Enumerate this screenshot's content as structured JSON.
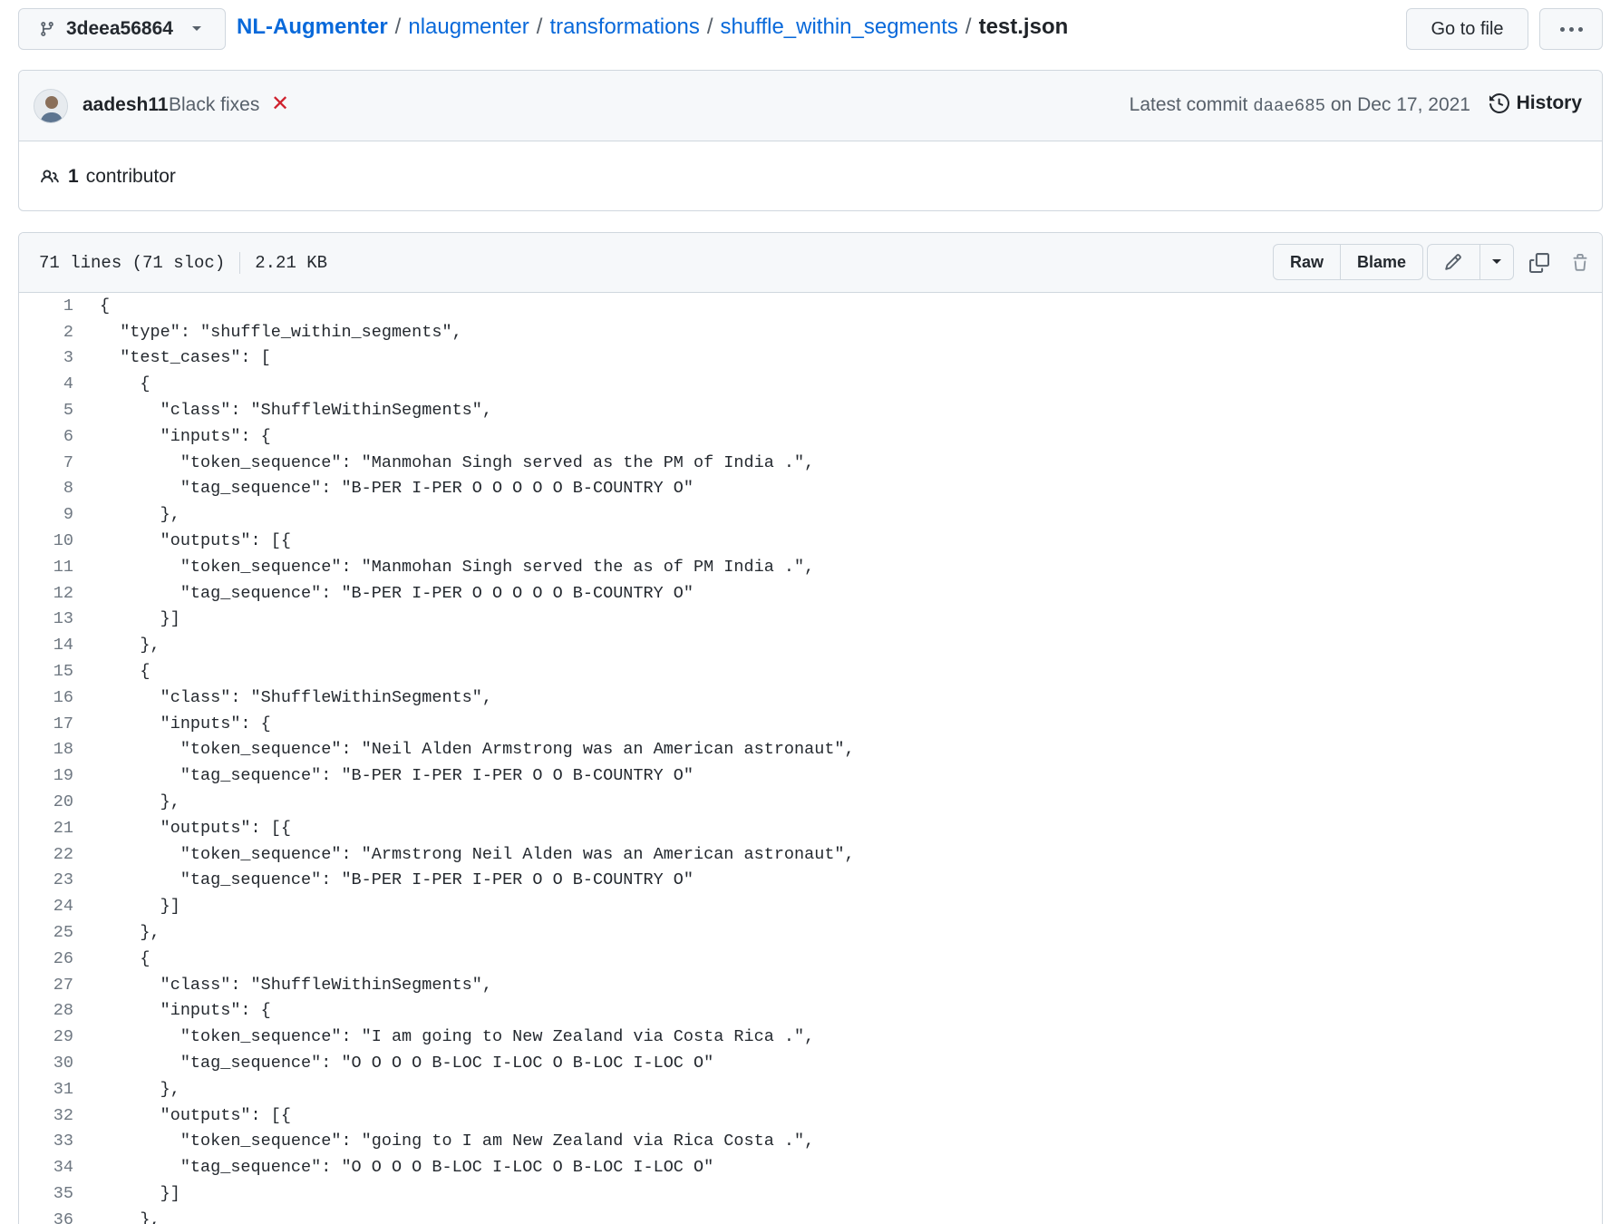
{
  "branch": {
    "name": "3deea56864"
  },
  "breadcrumb": {
    "repo": "NL-Augmenter",
    "path": [
      "nlaugmenter",
      "transformations",
      "shuffle_within_segments"
    ],
    "file": "test.json"
  },
  "actions": {
    "goto_file": "Go to file"
  },
  "commit": {
    "author": "aadesh11",
    "message": "Black fixes",
    "status_icon": "x-icon",
    "latest_label": "Latest commit",
    "sha": "daae685",
    "date_text": "on Dec 17, 2021",
    "history_label": "History"
  },
  "contributors": {
    "count": "1",
    "label": "contributor"
  },
  "file": {
    "lines_info": "71 lines (71 sloc)",
    "size": "2.21 KB",
    "raw_label": "Raw",
    "blame_label": "Blame"
  },
  "code_lines": [
    {
      "n": "1",
      "text": "{"
    },
    {
      "n": "2",
      "text": "  \"type\": \"shuffle_within_segments\","
    },
    {
      "n": "3",
      "text": "  \"test_cases\": ["
    },
    {
      "n": "4",
      "text": "    {"
    },
    {
      "n": "5",
      "text": "      \"class\": \"ShuffleWithinSegments\","
    },
    {
      "n": "6",
      "text": "      \"inputs\": {"
    },
    {
      "n": "7",
      "text": "        \"token_sequence\": \"Manmohan Singh served as the PM of India .\","
    },
    {
      "n": "8",
      "text": "        \"tag_sequence\": \"B-PER I-PER O O O O O B-COUNTRY O\""
    },
    {
      "n": "9",
      "text": "      },"
    },
    {
      "n": "10",
      "text": "      \"outputs\": [{"
    },
    {
      "n": "11",
      "text": "        \"token_sequence\": \"Manmohan Singh served the as of PM India .\","
    },
    {
      "n": "12",
      "text": "        \"tag_sequence\": \"B-PER I-PER O O O O O B-COUNTRY O\""
    },
    {
      "n": "13",
      "text": "      }]"
    },
    {
      "n": "14",
      "text": "    },"
    },
    {
      "n": "15",
      "text": "    {"
    },
    {
      "n": "16",
      "text": "      \"class\": \"ShuffleWithinSegments\","
    },
    {
      "n": "17",
      "text": "      \"inputs\": {"
    },
    {
      "n": "18",
      "text": "        \"token_sequence\": \"Neil Alden Armstrong was an American astronaut\","
    },
    {
      "n": "19",
      "text": "        \"tag_sequence\": \"B-PER I-PER I-PER O O B-COUNTRY O\""
    },
    {
      "n": "20",
      "text": "      },"
    },
    {
      "n": "21",
      "text": "      \"outputs\": [{"
    },
    {
      "n": "22",
      "text": "        \"token_sequence\": \"Armstrong Neil Alden was an American astronaut\","
    },
    {
      "n": "23",
      "text": "        \"tag_sequence\": \"B-PER I-PER I-PER O O B-COUNTRY O\""
    },
    {
      "n": "24",
      "text": "      }]"
    },
    {
      "n": "25",
      "text": "    },"
    },
    {
      "n": "26",
      "text": "    {"
    },
    {
      "n": "27",
      "text": "      \"class\": \"ShuffleWithinSegments\","
    },
    {
      "n": "28",
      "text": "      \"inputs\": {"
    },
    {
      "n": "29",
      "text": "        \"token_sequence\": \"I am going to New Zealand via Costa Rica .\","
    },
    {
      "n": "30",
      "text": "        \"tag_sequence\": \"O O O O B-LOC I-LOC O B-LOC I-LOC O\""
    },
    {
      "n": "31",
      "text": "      },"
    },
    {
      "n": "32",
      "text": "      \"outputs\": [{"
    },
    {
      "n": "33",
      "text": "        \"token_sequence\": \"going to I am New Zealand via Rica Costa .\","
    },
    {
      "n": "34",
      "text": "        \"tag_sequence\": \"O O O O B-LOC I-LOC O B-LOC I-LOC O\""
    },
    {
      "n": "35",
      "text": "      }]"
    },
    {
      "n": "36",
      "text": "    },"
    }
  ]
}
